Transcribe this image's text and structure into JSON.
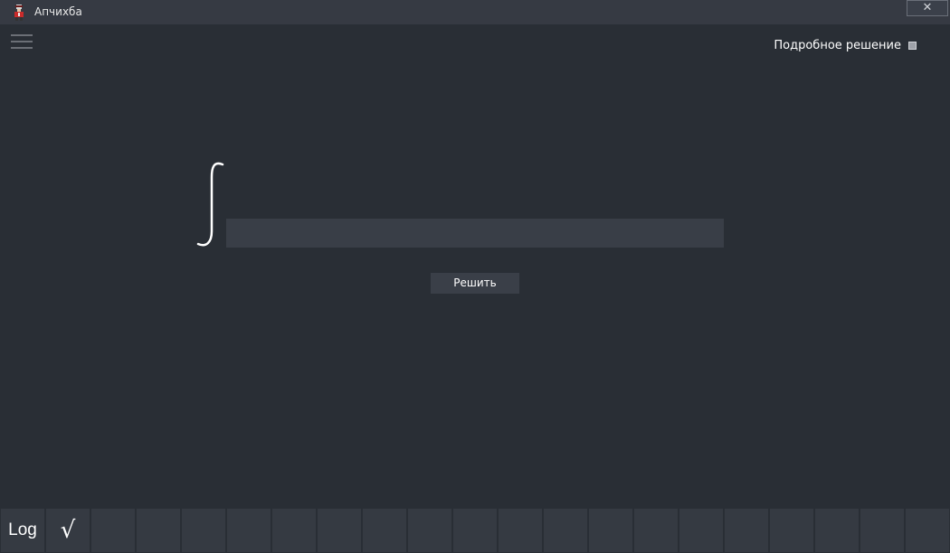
{
  "window": {
    "title": "Апчихба",
    "close_label": "✕",
    "app_icon": "app-icon"
  },
  "menu": {
    "icon": "hamburger-menu-icon"
  },
  "options": {
    "detailed_solution_label": "Подробное решение",
    "detailed_solution_checked": false
  },
  "main": {
    "integral_icon": "integral-sign-icon",
    "input_value": "",
    "solve_label": "Решить"
  },
  "keypad": {
    "keys": [
      "Log",
      "√",
      "",
      "",
      "",
      "",
      "",
      "",
      "",
      "",
      "",
      "",
      "",
      "",
      "",
      "",
      "",
      "",
      "",
      "",
      ""
    ]
  },
  "colors": {
    "background": "#292e35",
    "titlebar": "#363a43",
    "input": "#393e47",
    "button": "#3a3f48",
    "key": "#353a42"
  }
}
